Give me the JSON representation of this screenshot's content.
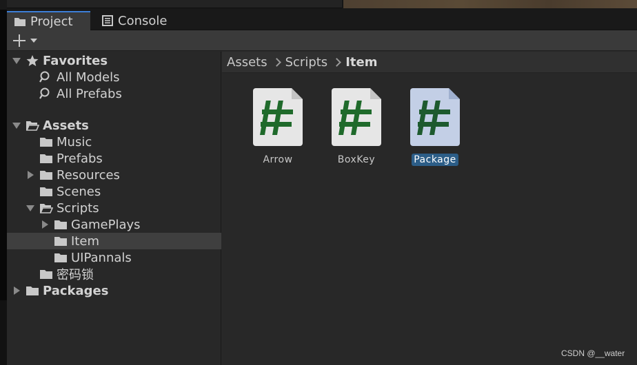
{
  "tabs": [
    {
      "label": "Project",
      "icon": "folder-icon",
      "active": true
    },
    {
      "label": "Console",
      "icon": "console-icon",
      "active": false
    }
  ],
  "toolbar": {
    "create_icon": "plus-icon",
    "dropdown_icon": "caret-down-icon"
  },
  "tree": {
    "favorites": {
      "label": "Favorites",
      "items": [
        {
          "label": "All Models",
          "icon": "search-icon"
        },
        {
          "label": "All Prefabs",
          "icon": "search-icon"
        }
      ]
    },
    "assets": {
      "label": "Assets",
      "items": [
        {
          "label": "Music"
        },
        {
          "label": "Prefabs"
        },
        {
          "label": "Resources"
        },
        {
          "label": "Scenes"
        },
        {
          "label": "Scripts"
        },
        {
          "label": "GamePlays"
        },
        {
          "label": "Item"
        },
        {
          "label": "UIPannals"
        },
        {
          "label": "密码锁"
        }
      ]
    },
    "packages": {
      "label": "Packages"
    }
  },
  "breadcrumb": [
    "Assets",
    "Scripts",
    "Item"
  ],
  "assets_grid": [
    {
      "label": "Arrow",
      "icon": "csharp-script-icon",
      "selected": false
    },
    {
      "label": "BoxKey",
      "icon": "csharp-script-icon",
      "selected": false
    },
    {
      "label": "Package",
      "icon": "csharp-script-icon",
      "selected": true
    }
  ],
  "colors": {
    "accent": "#3d7fd9",
    "selection": "#2c5d87",
    "hash_green": "#1f6a2b"
  },
  "watermark": "CSDN @__water"
}
